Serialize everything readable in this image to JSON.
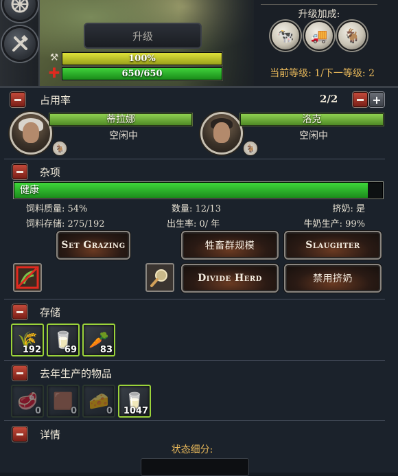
{
  "top": {
    "upgrade_label": "升级",
    "stamina_value": "100%",
    "health_value": "650/650",
    "bonus_title": "升级加成:",
    "level_text": "当前等级: 1/下一等级: 2"
  },
  "occupancy": {
    "title": "占用率",
    "count": "2/2",
    "workers": [
      {
        "name": "蒂拉娜",
        "status": "空闲中"
      },
      {
        "name": "洛克",
        "status": "空闲中"
      }
    ]
  },
  "misc": {
    "title": "杂项",
    "health_label": "健康",
    "health_fill": 0.96,
    "stats": {
      "feed_quality": "饲料质量: 54%",
      "quantity": "数量: 12/13",
      "milking": "挤奶: 是",
      "feed_storage": "饲料存储: 275/192",
      "birth_rate": "出生率: 0/ 年",
      "milk_production": "牛奶生产: 99%"
    },
    "buttons": {
      "set_grazing": "Set Grazing",
      "herd_size": "牲畜群规模",
      "slaughter": "Slaughter",
      "divide_herd": "Divide Herd",
      "disable_milking": "禁用挤奶"
    }
  },
  "storage": {
    "title": "存储",
    "items": [
      {
        "icon": "wheat-icon",
        "count": "192"
      },
      {
        "icon": "milk-bucket-icon",
        "count": "69"
      },
      {
        "icon": "vegetables-icon",
        "count": "83"
      }
    ]
  },
  "last_year": {
    "title": "去年生产的物品",
    "items": [
      {
        "icon": "meat-icon",
        "count": "0"
      },
      {
        "icon": "hide-icon",
        "count": "0"
      },
      {
        "icon": "cheese-icon",
        "count": "0"
      },
      {
        "icon": "milk-bucket-icon",
        "count": "1047"
      }
    ]
  },
  "details": {
    "title": "详情",
    "breakdown": "状态细分:"
  },
  "colors": {
    "health_green": "#2bbf2b",
    "accent_gold": "#e8b85a",
    "stamina_yellow": "#c7c91e",
    "hp_green": "#2ca82c"
  }
}
